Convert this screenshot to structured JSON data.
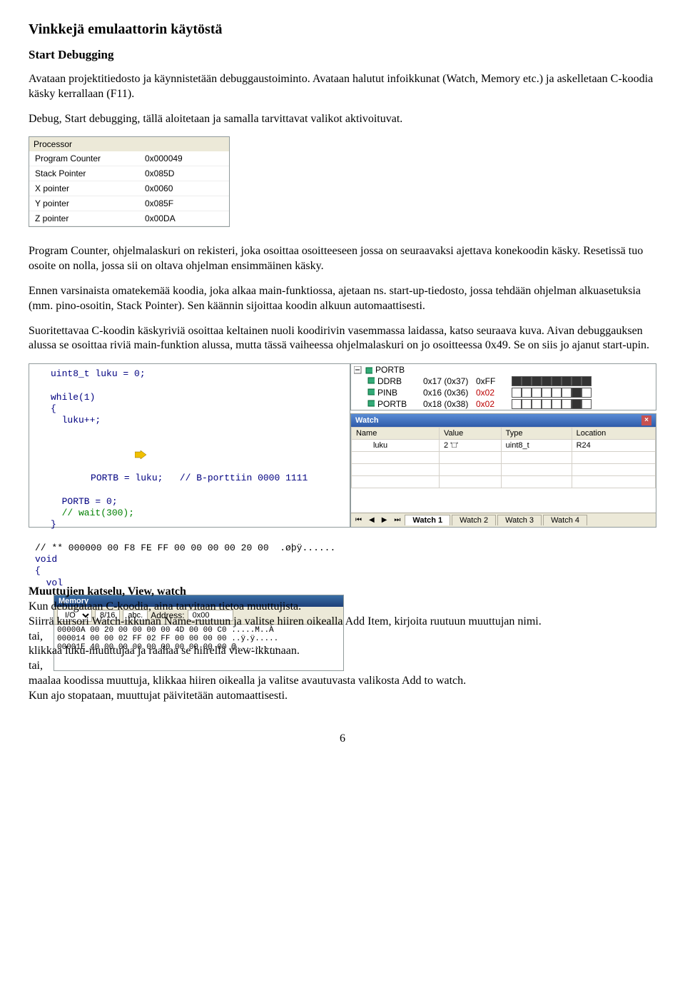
{
  "title": "Vinkkejä emulaattorin käytöstä",
  "section1": "Start Debugging",
  "para1": "Avataan projektitiedosto ja käynnistetään debuggaustoiminto. Avataan halutut infoikkunat (Watch, Memory etc.) ja askelletaan C-koodia käsky kerrallaan (F11).",
  "para2": "Debug, Start debugging, tällä aloitetaan ja samalla tarvittavat valikot aktivoituvat.",
  "processor": {
    "header": "Processor",
    "rows": [
      {
        "k": "Program Counter",
        "v": "0x000049"
      },
      {
        "k": "Stack Pointer",
        "v": "0x085D"
      },
      {
        "k": "X pointer",
        "v": "0x0060"
      },
      {
        "k": "Y pointer",
        "v": "0x085F"
      },
      {
        "k": "Z pointer",
        "v": "0x00DA"
      }
    ]
  },
  "para3": "Program Counter, ohjelmalaskuri on rekisteri, joka osoittaa osoitteeseen jossa on seuraavaksi ajettava konekoodin käsky. Resetissä tuo osoite on nolla, jossa sii on oltava ohjelman ensimmäinen käsky.",
  "para4": "Ennen varsinaista omatekemää koodia, joka alkaa main-funktiossa, ajetaan ns. start-up-tiedosto, jossa tehdään ohjelman alkuasetuksia (mm. pino-osoitin, Stack Pointer). Sen käännin sijoittaa koodin alkuun automaattisesti.",
  "para5": "Suoritettavaa C-koodin käskyriviä osoittaa keltainen nuoli koodirivin vasemmassa laidassa, katso seuraava kuva. Aivan debuggauksen alussa se osoittaa riviä main-funktion alussa, mutta tässä vaiheessa ohjelmalaskuri on jo osoitteessa 0x49. Se on siis jo ajanut start-upin.",
  "ide": {
    "code": {
      "l1": "uint8_t luku = 0;",
      "l2blank": "",
      "l3": "while(1)",
      "l4": "{",
      "l5": "  luku++;",
      "l6": "  PORTB = luku;   // B-porttiin 0000 1111",
      "l7": "  PORTB = 0;",
      "l8": "  // wait(300);",
      "l9": "}",
      "l10blank": "",
      "l11": "// ** 000000 00 F8 FE FF 00 00 00 00 20 00  .øþÿ......",
      "l12": "void",
      "l13": "{",
      "l14": "  vol"
    },
    "memory": {
      "title": "Memory",
      "io_label": "I/O",
      "btn816": "8/16",
      "btn_abc": "abc.",
      "addr_label": "Address:",
      "addr_value": "0x00",
      "lines": [
        "00000A 00 20 00 00 00 00 4D 00 00 C0  .....M..À",
        "000014 00 00 02 FF 02 FF 00 00 00 00  ..ÿ.ÿ.....",
        "00001E 40 00 00 00 00 00 00 00 00 00  @........."
      ]
    },
    "ioview": {
      "group": "PORTB",
      "rows": [
        {
          "icon": "reg",
          "name": "DDRB",
          "addr": "0x17 (0x37)",
          "val": "0xFF",
          "bits": [
            1,
            1,
            1,
            1,
            1,
            1,
            1,
            1
          ],
          "red": false
        },
        {
          "icon": "reg",
          "name": "PINB",
          "addr": "0x16 (0x36)",
          "val": "0x02",
          "bits": [
            0,
            0,
            0,
            0,
            0,
            0,
            1,
            0
          ],
          "red": true
        },
        {
          "icon": "reg",
          "name": "PORTB",
          "addr": "0x18 (0x38)",
          "val": "0x02",
          "bits": [
            0,
            0,
            0,
            0,
            0,
            0,
            1,
            0
          ],
          "red": true
        }
      ]
    },
    "watch": {
      "title": "Watch",
      "cols": [
        "Name",
        "Value",
        "Type",
        "Location"
      ],
      "row": {
        "name": "luku",
        "value": "2 '□'",
        "type": "uint8_t",
        "loc": "R24"
      },
      "tabs": [
        "Watch 1",
        "Watch 2",
        "Watch 3",
        "Watch 4"
      ]
    }
  },
  "section2": "Muuttujien katselu, View, watch",
  "para6": "Kun debugataan C-koodia, aina tarvitaan tietoa muuttujista.",
  "para7": "Siirrä kursori Watch-ikkunan Name-ruutuun ja valitse hiiren oikealla Add Item, kirjoita ruutuun muuttujan nimi.",
  "para8": "tai,",
  "para9": "klikkaa luku-muuttujaa ja raahaa se hiirellä view-ikkunaan.",
  "para10": "tai,",
  "para11": "maalaa koodissa muuttuja, klikkaa hiiren oikealla ja valitse avautuvasta valikosta Add to watch.",
  "para12": "Kun ajo stopataan, muuttujat päivitetään automaattisesti.",
  "page": "6"
}
